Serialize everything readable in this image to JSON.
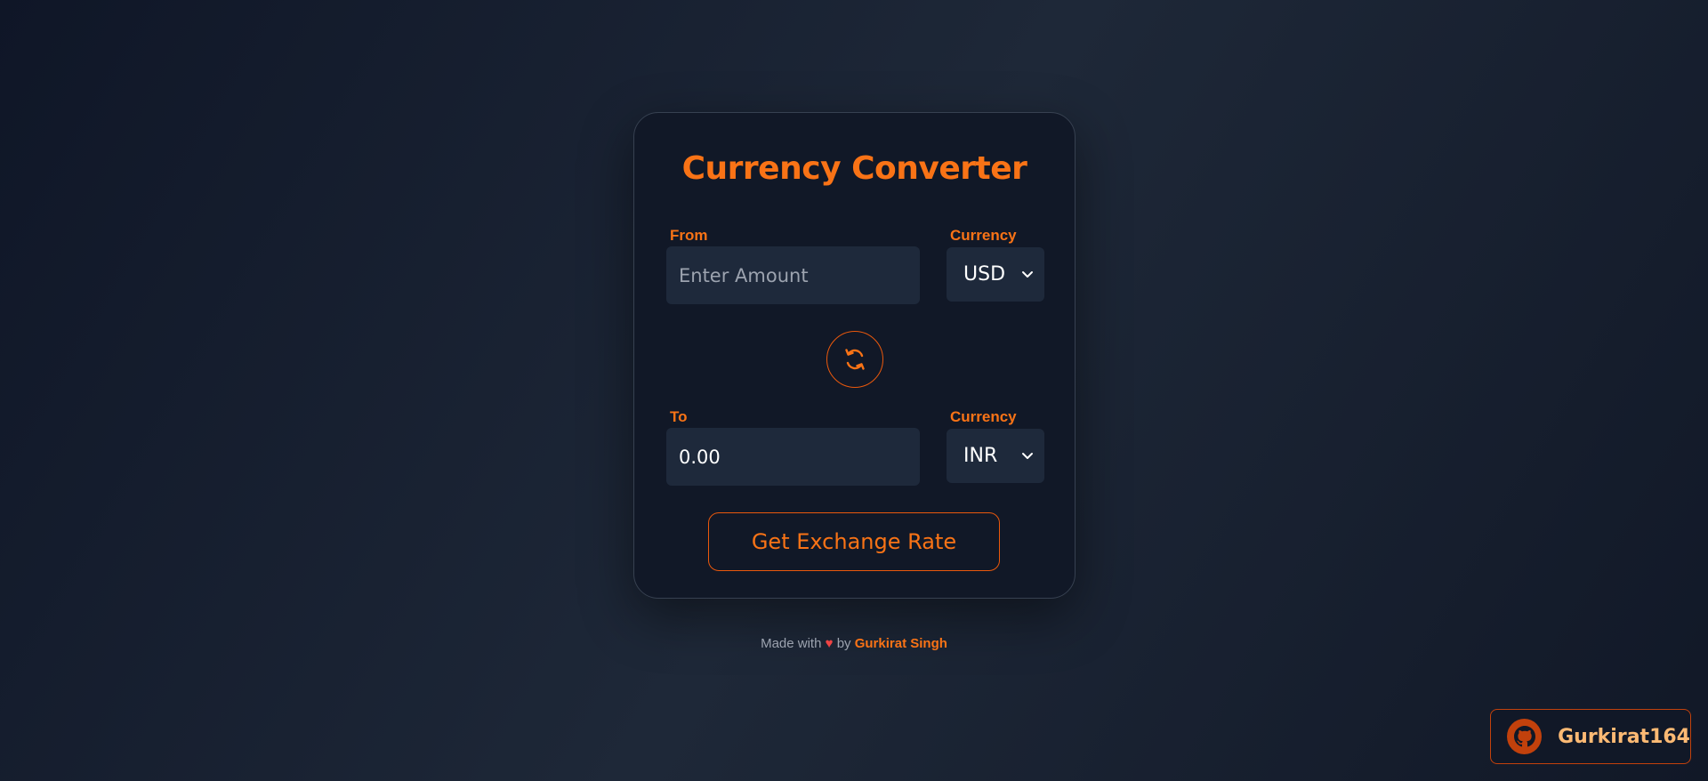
{
  "app": {
    "title": "Currency Converter"
  },
  "from": {
    "label": "From",
    "placeholder": "Enter Amount",
    "currency_label": "Currency",
    "currency_value": "USD"
  },
  "to": {
    "label": "To",
    "value": "0.00",
    "currency_label": "Currency",
    "currency_value": "INR"
  },
  "actions": {
    "swap_icon": "swap-arrows-icon",
    "get_rate_label": "Get Exchange Rate"
  },
  "footer": {
    "made_with": "Made with",
    "heart": "♥",
    "by": "by",
    "author": "Gurkirat Singh"
  },
  "github_badge": {
    "icon": "github-icon",
    "username": "Gurkirat164"
  },
  "colors": {
    "accent": "#f97316",
    "accent_border": "#ea580c",
    "card_bg": "#111827",
    "input_bg": "#1e293b",
    "heart": "#ef4444"
  }
}
